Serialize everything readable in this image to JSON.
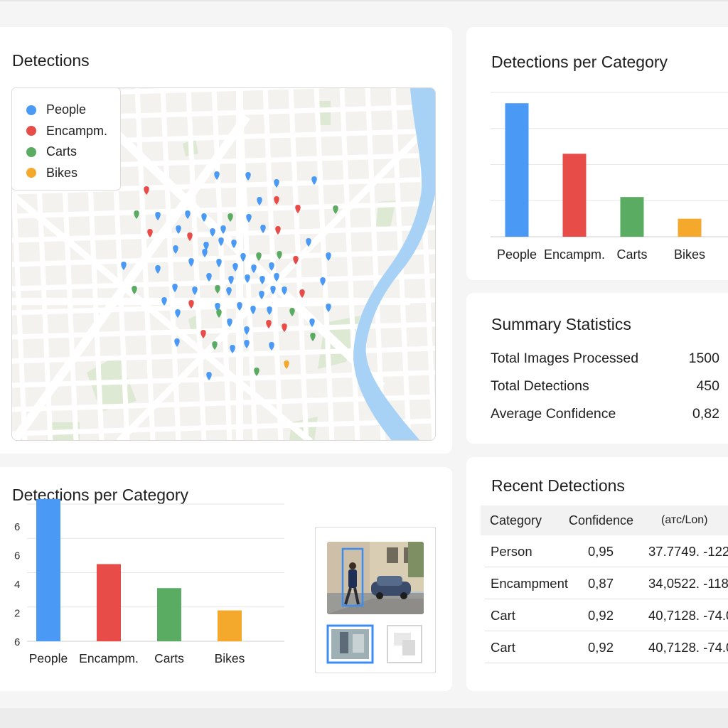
{
  "colors": {
    "people": "#4a9af5",
    "encampments": "#e84c48",
    "carts": "#5aac62",
    "bikes": "#f5a92c",
    "water": "#a8d2f5",
    "park": "#dde9d2"
  },
  "map_panel": {
    "title": "Detections",
    "legend": [
      {
        "label": "People",
        "color": "#4a9af5"
      },
      {
        "label": "Encampm.",
        "color": "#e84c48"
      },
      {
        "label": "Carts",
        "color": "#5aac62"
      },
      {
        "label": "Bikes",
        "color": "#f5a92c"
      }
    ]
  },
  "top_chart": {
    "title": "Detections per Category"
  },
  "summary": {
    "title": "Summary Statistics",
    "stats": [
      {
        "label": "Total Images Processed",
        "value": "1500"
      },
      {
        "label": "Total Detections",
        "value": "450"
      },
      {
        "label": "Average Confidence",
        "value": "0,82"
      }
    ]
  },
  "bottom_chart": {
    "title": "Detections per Category"
  },
  "recent": {
    "title": "Recent Detections",
    "headers": [
      "Category",
      "Confidence",
      "(атс/Lon)"
    ],
    "rows": [
      [
        "Person",
        "0,95",
        "37.7749. -122"
      ],
      [
        "Encampment",
        "0,87",
        "34,0522. -118"
      ],
      [
        "Cart",
        "0,92",
        "40,7128. -74.0"
      ],
      [
        "Cart",
        "0,92",
        "40,7128. -74.0"
      ]
    ]
  },
  "chart_data": [
    {
      "type": "bar",
      "categories": [
        "People",
        "Encampm.",
        "Carts",
        "Bikes"
      ],
      "values": [
        3.7,
        2.3,
        1.1,
        0.5
      ],
      "title": "Detections per Category",
      "ylim": [
        0,
        4
      ],
      "grid": true,
      "colors": [
        "#4a9af5",
        "#e84c48",
        "#5aac62",
        "#f5a92c"
      ]
    },
    {
      "type": "bar",
      "categories": [
        "People",
        "Encampm.",
        "Carts",
        "Bikes"
      ],
      "values": [
        8.3,
        4.5,
        3.1,
        1.8
      ],
      "title": "Detections per Category",
      "yticks": [
        "6",
        "6",
        "4",
        "2",
        "6"
      ],
      "ylim": [
        0,
        8
      ],
      "grid": true,
      "colors": [
        "#4a9af5",
        "#e84c48",
        "#5aac62",
        "#f5a92c"
      ]
    }
  ]
}
